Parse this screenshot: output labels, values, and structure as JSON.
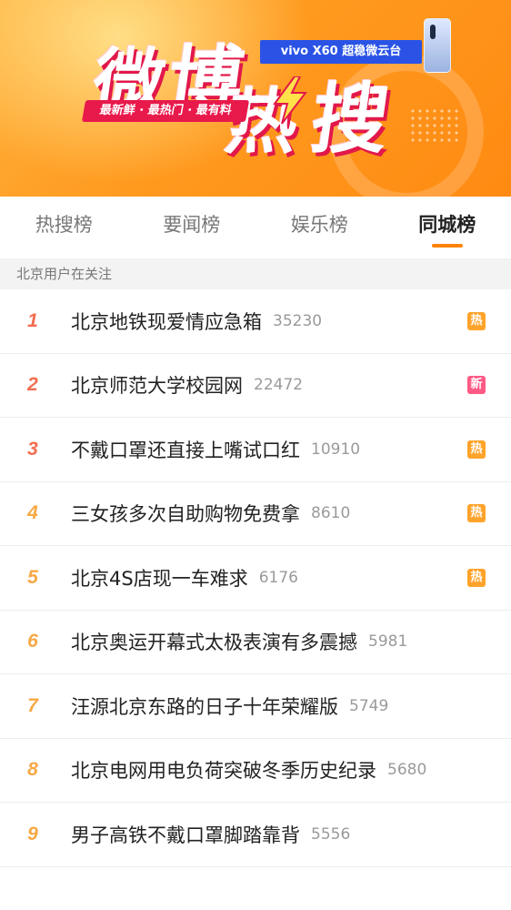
{
  "banner": {
    "logo_chars": [
      "微",
      "博",
      "热",
      "搜"
    ],
    "slogan": "最新鲜 · 最热门 · 最有料",
    "ad_text": "vivo X60 超稳微云台",
    "colors": {
      "background": "#ff9a1f",
      "accent": "#e8194b",
      "ad": "#2a53e6"
    }
  },
  "tabs": [
    {
      "label": "热搜榜",
      "active": false
    },
    {
      "label": "要闻榜",
      "active": false
    },
    {
      "label": "娱乐榜",
      "active": false
    },
    {
      "label": "同城榜",
      "active": true
    }
  ],
  "section_header": "北京用户在关注",
  "items": [
    {
      "rank": "1",
      "title": "北京地铁现爱情应急箱",
      "count": "35230",
      "badge": "热"
    },
    {
      "rank": "2",
      "title": "北京师范大学校园网",
      "count": "22472",
      "badge": "新"
    },
    {
      "rank": "3",
      "title": "不戴口罩还直接上嘴试口红",
      "count": "10910",
      "badge": "热"
    },
    {
      "rank": "4",
      "title": "三女孩多次自助购物免费拿",
      "count": "8610",
      "badge": "热"
    },
    {
      "rank": "5",
      "title": "北京4S店现一车难求",
      "count": "6176",
      "badge": "热"
    },
    {
      "rank": "6",
      "title": "北京奥运开幕式太极表演有多震撼",
      "count": "5981",
      "badge": ""
    },
    {
      "rank": "7",
      "title": "汪源北京东路的日子十年荣耀版",
      "count": "5749",
      "badge": ""
    },
    {
      "rank": "8",
      "title": "北京电网用电负荷突破冬季历史纪录",
      "count": "5680",
      "badge": ""
    },
    {
      "rank": "9",
      "title": "男子高铁不戴口罩脚踏靠背",
      "count": "5556",
      "badge": ""
    }
  ],
  "rank_colors": {
    "top": "#f26c4f",
    "other": "#f7a845"
  },
  "badge_colors": {
    "热": "#ffa32b",
    "新": "#ff5a86"
  }
}
